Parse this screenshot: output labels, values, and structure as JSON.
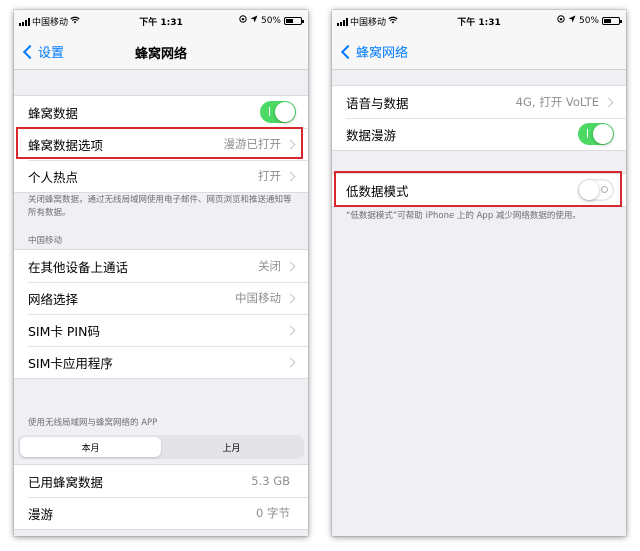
{
  "status_bar": {
    "carrier": "中国移动",
    "time": "下午 1:31",
    "battery_text": "50%",
    "battery_level": 0.5
  },
  "left_screen": {
    "back_label": "设置",
    "title": "蜂窝网络",
    "main_group": [
      {
        "label": "蜂窝数据",
        "toggle": "on"
      },
      {
        "label": "蜂窝数据选项",
        "value": "漫游已打开"
      },
      {
        "label": "个人热点",
        "value": "打开"
      }
    ],
    "main_footnote": "关闭蜂窝数据，通过无线局域网使用电子邮件、网页浏览和推送通知等所有数据。",
    "carrier_section": "中国移动",
    "carrier_group": [
      {
        "label": "在其他设备上通话",
        "value": "关闭"
      },
      {
        "label": "网络选择",
        "value": "中国移动"
      },
      {
        "label": "SIM卡 PIN码",
        "value": ""
      },
      {
        "label": "SIM卡应用程序",
        "value": ""
      }
    ],
    "usage_section": "使用无线局域网与蜂窝网络的 APP",
    "segments": [
      "本月",
      "上月"
    ],
    "usage_group": [
      {
        "label": "已用蜂窝数据",
        "value": "5.3 GB"
      },
      {
        "label": "漫游",
        "value": "0 字节"
      }
    ]
  },
  "right_screen": {
    "back_label": "蜂窝网络",
    "rows_group1": [
      {
        "label": "语音与数据",
        "value": "4G, 打开 VoLTE"
      },
      {
        "label": "数据漫游",
        "toggle": "on"
      }
    ],
    "low_data": {
      "label": "低数据模式",
      "toggle": "off"
    },
    "low_data_footnote": "“低数据模式”可帮助 iPhone 上的 App 减少网络数据的使用。"
  },
  "colors": {
    "accent": "#007aff",
    "toggle_on": "#4cd964",
    "highlight": "#d9272e",
    "background": "#efeff4"
  }
}
